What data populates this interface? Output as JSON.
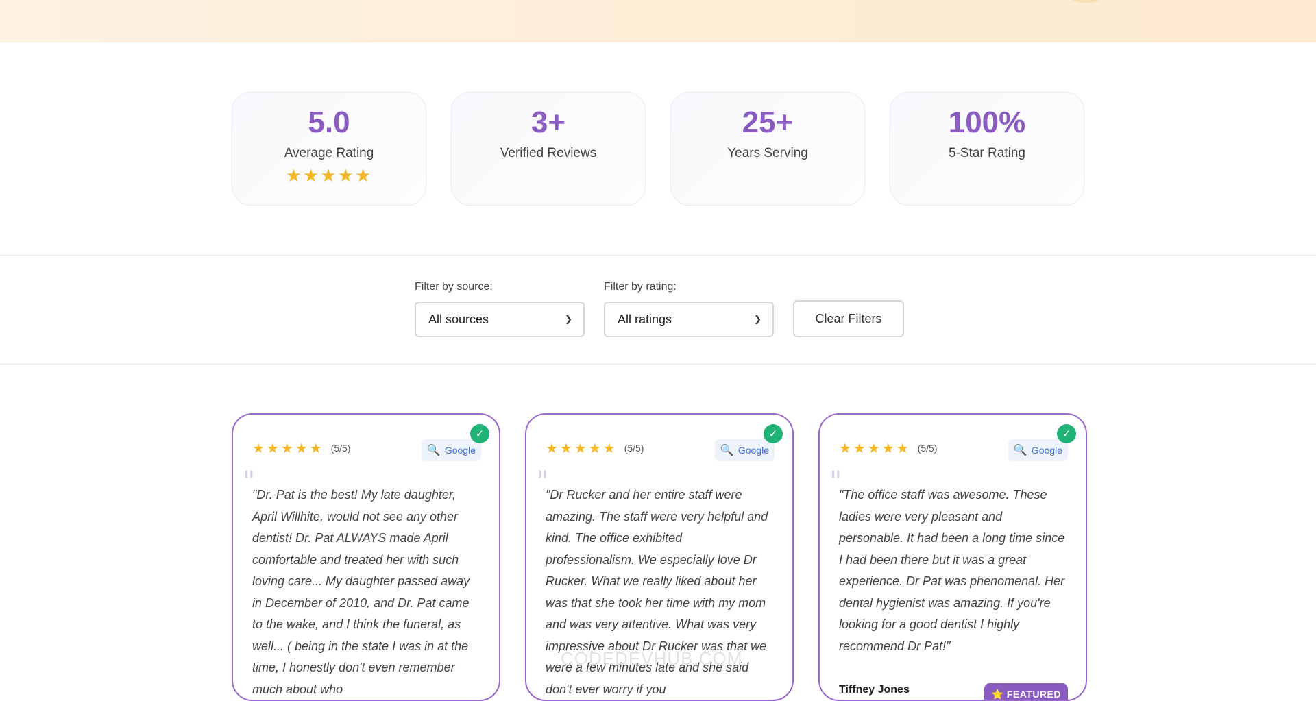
{
  "stats": [
    {
      "value": "5.0",
      "label": "Average Rating",
      "stars": "★★★★★"
    },
    {
      "value": "3+",
      "label": "Verified Reviews"
    },
    {
      "value": "25+",
      "label": "Years Serving"
    },
    {
      "value": "100%",
      "label": "5-Star Rating"
    }
  ],
  "filters": {
    "source_label": "Filter by source:",
    "source_value": "All sources",
    "rating_label": "Filter by rating:",
    "rating_value": "All ratings",
    "clear_label": "Clear Filters"
  },
  "reviews": [
    {
      "stars": "★★★★★",
      "score": "(5/5)",
      "source": "Google",
      "text": "\"Dr. Pat is the best! My late daughter, April Willhite, would not see any other dentist! Dr. Pat ALWAYS made April comfortable and treated her with such loving care... My daughter passed away in December of 2010, and Dr. Pat came to the wake, and I think the funeral, as well... ( being in the state I was in at the time, I honestly don't even remember much about who"
    },
    {
      "stars": "★★★★★",
      "score": "(5/5)",
      "source": "Google",
      "text": "\"Dr Rucker and her entire staff were amazing. The staff were very helpful and kind. The office exhibited professionalism. We especially love Dr Rucker. What we really liked about her was that she took her time with my mom and was very attentive. What was very impressive about Dr Rucker was that we were a few minutes late and she said don't ever worry if you"
    },
    {
      "stars": "★★★★★",
      "score": "(5/5)",
      "source": "Google",
      "text": "\"The office staff was awesome. These ladies were very pleasant and personable. It had been a long time since I had been there but it was a great experience. Dr Pat was phenomenal. Her dental hygienist was amazing. If you're looking for a good dentist I highly recommend Dr Pat!\"",
      "author": "Tiffney Jones",
      "badge": "⭐ FEATURED"
    }
  ],
  "watermark": "CODEDEVHUB.COM",
  "colors": {
    "accent": "#8a5cbf",
    "star": "#f5b824",
    "verified": "#1fb377"
  }
}
